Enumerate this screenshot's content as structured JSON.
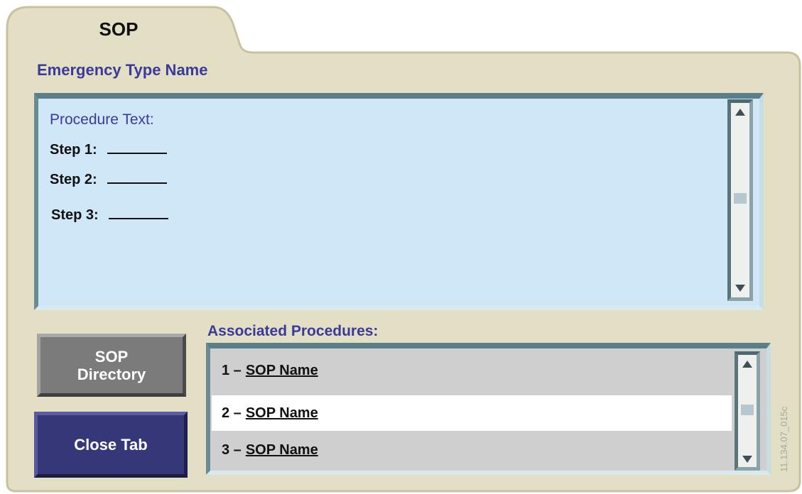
{
  "tab": {
    "title": "SOP"
  },
  "emergency": {
    "title": "Emergency Type Name"
  },
  "procedure": {
    "label": "Procedure Text:",
    "steps": [
      {
        "label": "Step 1:"
      },
      {
        "label": "Step 2:"
      },
      {
        "label": "Step 3:"
      }
    ]
  },
  "buttons": {
    "directory_line1": "SOP",
    "directory_line2": "Directory",
    "close": "Close Tab"
  },
  "associated": {
    "title": "Associated Procedures:",
    "items": [
      {
        "num": "1 –",
        "name": "SOP Name"
      },
      {
        "num": "2 –",
        "name": "SOP Name"
      },
      {
        "num": "3 –",
        "name": "SOP Name"
      }
    ]
  },
  "watermark": "11.134.07_015c",
  "colors": {
    "panel": "#e3dfc4",
    "panel_border": "#cbc6a6",
    "heading": "#3b3a9c",
    "text_area": "#cfe7f7",
    "close_button": "#363779",
    "directory_button": "#7b7b7b"
  },
  "icons": {
    "scroll_up": "triangle-up-icon",
    "scroll_down": "triangle-down-icon"
  }
}
